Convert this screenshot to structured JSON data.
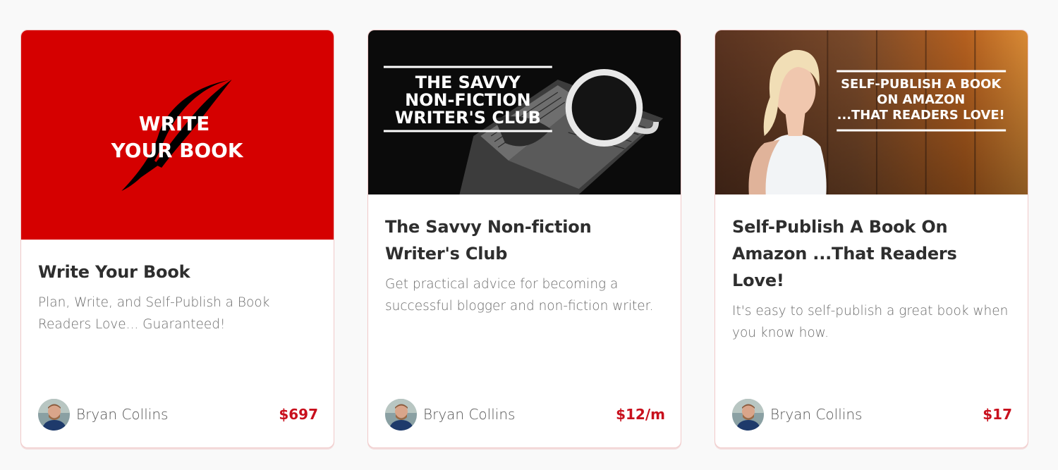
{
  "cards": [
    {
      "thumb_text": [
        "WRITE",
        "YOUR BOOK"
      ],
      "title": "Write Your Book",
      "description": "Plan, Write, and Self-Publish a Book Readers Love... Guaranteed!",
      "author": "Bryan Collins",
      "price": "$697",
      "thumb_bg": "#d50000"
    },
    {
      "thumb_text": [
        "THE SAVVY",
        "NON-FICTION",
        "WRITER'S CLUB"
      ],
      "title": "The Savvy Non-fiction Writer's Club",
      "description": "Get practical advice for becoming a successful blogger and non-fiction writer.",
      "author": "Bryan Collins",
      "price": "$12/m"
    },
    {
      "thumb_text": [
        "SELF-PUBLISH A BOOK",
        "ON AMAZON",
        "...THAT READERS LOVE!"
      ],
      "title": "Self-Publish A Book On Amazon ...That Readers Love!",
      "description": "It's easy to self-publish a great book when you know how.",
      "author": "Bryan Collins",
      "price": "$17"
    }
  ],
  "colors": {
    "price": "#c8101d",
    "border": "#f1c9c9",
    "title": "#2e2e2e"
  }
}
